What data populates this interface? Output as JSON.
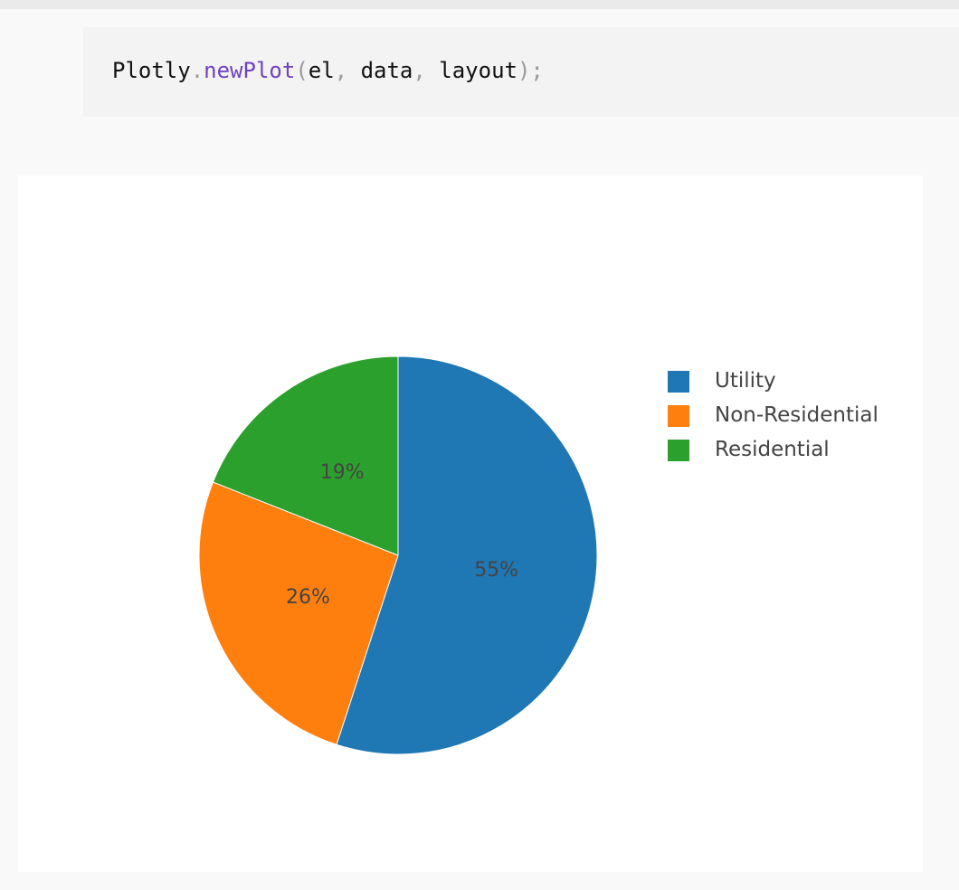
{
  "code": {
    "obj": "Plotly",
    "dot": ".",
    "fn": "newPlot",
    "open": "(",
    "arg1": "el",
    "comma1": ",",
    "arg2": "data",
    "comma2": ",",
    "arg3": "layout",
    "close": ");"
  },
  "chart_data": {
    "type": "pie",
    "labels": [
      "Utility",
      "Non-Residential",
      "Residential"
    ],
    "values": [
      55,
      26,
      19
    ],
    "value_labels": [
      "55%",
      "26%",
      "19%"
    ],
    "colors": [
      "#1f77b4",
      "#ff7f0e",
      "#2ca02c"
    ],
    "legend_position": "right"
  }
}
